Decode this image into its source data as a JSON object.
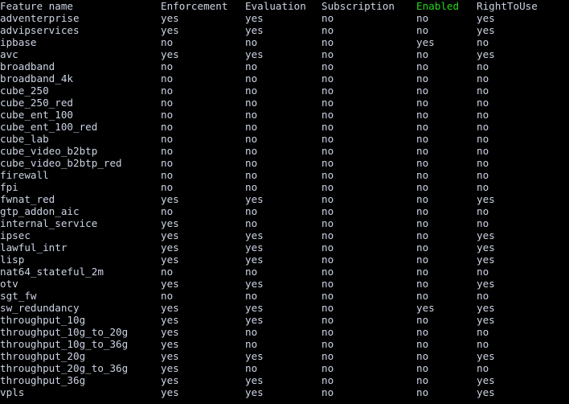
{
  "terminal": {
    "background_color": "#000000",
    "text_color": "#ccd4e4",
    "accent_color": "#23d918"
  },
  "table": {
    "headers": {
      "feature": "Feature name",
      "enforcement": "Enforcement",
      "evaluation": "Evaluation",
      "subscription": "Subscription",
      "enabled": "Enabled",
      "righttouse": "RightToUse"
    },
    "rows": [
      {
        "feature": "adventerprise",
        "enforcement": "yes",
        "evaluation": "yes",
        "subscription": "no",
        "enabled": "no",
        "righttouse": "yes"
      },
      {
        "feature": "advipservices",
        "enforcement": "yes",
        "evaluation": "yes",
        "subscription": "no",
        "enabled": "no",
        "righttouse": "yes"
      },
      {
        "feature": "ipbase",
        "enforcement": "no",
        "evaluation": "no",
        "subscription": "no",
        "enabled": "yes",
        "righttouse": "no"
      },
      {
        "feature": "avc",
        "enforcement": "yes",
        "evaluation": "yes",
        "subscription": "no",
        "enabled": "no",
        "righttouse": "yes"
      },
      {
        "feature": "broadband",
        "enforcement": "no",
        "evaluation": "no",
        "subscription": "no",
        "enabled": "no",
        "righttouse": "no"
      },
      {
        "feature": "broadband_4k",
        "enforcement": "no",
        "evaluation": "no",
        "subscription": "no",
        "enabled": "no",
        "righttouse": "no"
      },
      {
        "feature": "cube_250",
        "enforcement": "no",
        "evaluation": "no",
        "subscription": "no",
        "enabled": "no",
        "righttouse": "no"
      },
      {
        "feature": "cube_250_red",
        "enforcement": "no",
        "evaluation": "no",
        "subscription": "no",
        "enabled": "no",
        "righttouse": "no"
      },
      {
        "feature": "cube_ent_100",
        "enforcement": "no",
        "evaluation": "no",
        "subscription": "no",
        "enabled": "no",
        "righttouse": "no"
      },
      {
        "feature": "cube_ent_100_red",
        "enforcement": "no",
        "evaluation": "no",
        "subscription": "no",
        "enabled": "no",
        "righttouse": "no"
      },
      {
        "feature": "cube_lab",
        "enforcement": "no",
        "evaluation": "no",
        "subscription": "no",
        "enabled": "no",
        "righttouse": "no"
      },
      {
        "feature": "cube_video_b2btp",
        "enforcement": "no",
        "evaluation": "no",
        "subscription": "no",
        "enabled": "no",
        "righttouse": "no"
      },
      {
        "feature": "cube_video_b2btp_red",
        "enforcement": "no",
        "evaluation": "no",
        "subscription": "no",
        "enabled": "no",
        "righttouse": "no"
      },
      {
        "feature": "firewall",
        "enforcement": "no",
        "evaluation": "no",
        "subscription": "no",
        "enabled": "no",
        "righttouse": "no"
      },
      {
        "feature": "fpi",
        "enforcement": "no",
        "evaluation": "no",
        "subscription": "no",
        "enabled": "no",
        "righttouse": "no"
      },
      {
        "feature": "fwnat_red",
        "enforcement": "yes",
        "evaluation": "yes",
        "subscription": "no",
        "enabled": "no",
        "righttouse": "yes"
      },
      {
        "feature": "gtp_addon_aic",
        "enforcement": "no",
        "evaluation": "no",
        "subscription": "no",
        "enabled": "no",
        "righttouse": "no"
      },
      {
        "feature": "internal_service",
        "enforcement": "yes",
        "evaluation": "no",
        "subscription": "no",
        "enabled": "no",
        "righttouse": "no"
      },
      {
        "feature": "ipsec",
        "enforcement": "yes",
        "evaluation": "yes",
        "subscription": "no",
        "enabled": "no",
        "righttouse": "yes"
      },
      {
        "feature": "lawful_intr",
        "enforcement": "yes",
        "evaluation": "yes",
        "subscription": "no",
        "enabled": "no",
        "righttouse": "yes"
      },
      {
        "feature": "lisp",
        "enforcement": "yes",
        "evaluation": "yes",
        "subscription": "no",
        "enabled": "no",
        "righttouse": "yes"
      },
      {
        "feature": "nat64_stateful_2m",
        "enforcement": "no",
        "evaluation": "no",
        "subscription": "no",
        "enabled": "no",
        "righttouse": "no"
      },
      {
        "feature": "otv",
        "enforcement": "yes",
        "evaluation": "yes",
        "subscription": "no",
        "enabled": "no",
        "righttouse": "yes"
      },
      {
        "feature": "sgt_fw",
        "enforcement": "no",
        "evaluation": "no",
        "subscription": "no",
        "enabled": "no",
        "righttouse": "no"
      },
      {
        "feature": "sw_redundancy",
        "enforcement": "yes",
        "evaluation": "yes",
        "subscription": "no",
        "enabled": "yes",
        "righttouse": "yes"
      },
      {
        "feature": "throughput_10g",
        "enforcement": "yes",
        "evaluation": "yes",
        "subscription": "no",
        "enabled": "no",
        "righttouse": "yes"
      },
      {
        "feature": "throughput_10g_to_20g",
        "enforcement": "yes",
        "evaluation": "no",
        "subscription": "no",
        "enabled": "no",
        "righttouse": "no"
      },
      {
        "feature": "throughput_10g_to_36g",
        "enforcement": "yes",
        "evaluation": "no",
        "subscription": "no",
        "enabled": "no",
        "righttouse": "no"
      },
      {
        "feature": "throughput_20g",
        "enforcement": "yes",
        "evaluation": "yes",
        "subscription": "no",
        "enabled": "no",
        "righttouse": "yes"
      },
      {
        "feature": "throughput_20g_to_36g",
        "enforcement": "yes",
        "evaluation": "no",
        "subscription": "no",
        "enabled": "no",
        "righttouse": "no"
      },
      {
        "feature": "throughput_36g",
        "enforcement": "yes",
        "evaluation": "yes",
        "subscription": "no",
        "enabled": "no",
        "righttouse": "yes"
      },
      {
        "feature": "vpls",
        "enforcement": "yes",
        "evaluation": "yes",
        "subscription": "no",
        "enabled": "no",
        "righttouse": "yes"
      }
    ]
  }
}
